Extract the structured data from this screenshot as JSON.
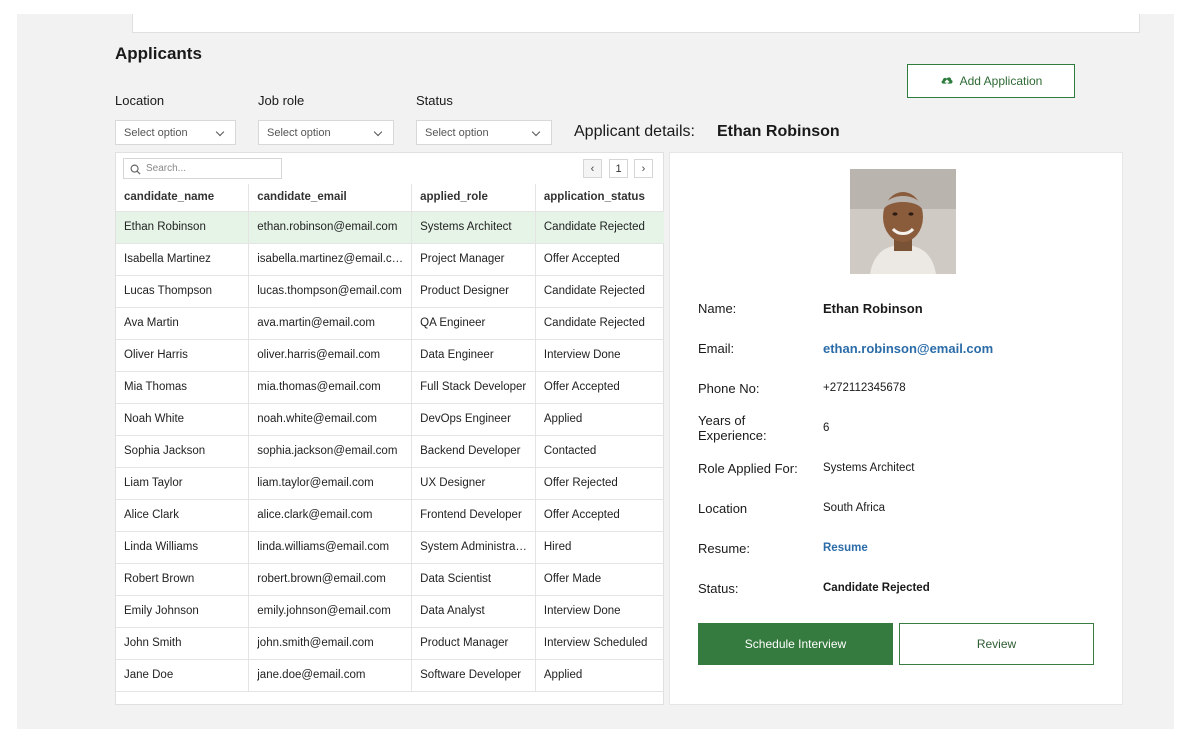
{
  "page": {
    "title": "Applicants",
    "add_button": "Add Application"
  },
  "filters": [
    {
      "label": "Location",
      "placeholder": "Select option"
    },
    {
      "label": "Job role",
      "placeholder": "Select option"
    },
    {
      "label": "Status",
      "placeholder": "Select option"
    }
  ],
  "table": {
    "search_placeholder": "Search...",
    "page": "1",
    "columns": [
      "candidate_name",
      "candidate_email",
      "applied_role",
      "application_status"
    ],
    "rows": [
      [
        "Ethan Robinson",
        "ethan.robinson@email.com",
        "Systems Architect",
        "Candidate Rejected"
      ],
      [
        "Isabella Martinez",
        "isabella.martinez@email.c…",
        "Project Manager",
        "Offer Accepted"
      ],
      [
        "Lucas Thompson",
        "lucas.thompson@email.com",
        "Product Designer",
        "Candidate Rejected"
      ],
      [
        "Ava Martin",
        "ava.martin@email.com",
        "QA Engineer",
        "Candidate Rejected"
      ],
      [
        "Oliver Harris",
        "oliver.harris@email.com",
        "Data Engineer",
        "Interview Done"
      ],
      [
        "Mia Thomas",
        "mia.thomas@email.com",
        "Full Stack Developer",
        "Offer Accepted"
      ],
      [
        "Noah White",
        "noah.white@email.com",
        "DevOps Engineer",
        "Applied"
      ],
      [
        "Sophia Jackson",
        "sophia.jackson@email.com",
        "Backend Developer",
        "Contacted"
      ],
      [
        "Liam Taylor",
        "liam.taylor@email.com",
        "UX Designer",
        "Offer Rejected"
      ],
      [
        "Alice Clark",
        "alice.clark@email.com",
        "Frontend Developer",
        "Offer Accepted"
      ],
      [
        "Linda Williams",
        "linda.williams@email.com",
        "System Administra…",
        "Hired"
      ],
      [
        "Robert Brown",
        "robert.brown@email.com",
        "Data Scientist",
        "Offer Made"
      ],
      [
        "Emily Johnson",
        "emily.johnson@email.com",
        "Data Analyst",
        "Interview Done"
      ],
      [
        "John Smith",
        "john.smith@email.com",
        "Product Manager",
        "Interview Scheduled"
      ],
      [
        "Jane Doe",
        "jane.doe@email.com",
        "Software Developer",
        "Applied"
      ]
    ],
    "selected_row": 0
  },
  "details": {
    "heading": "Applicant details:",
    "name_heading": "Ethan Robinson",
    "fields": {
      "name_label": "Name:",
      "name": "Ethan Robinson",
      "email_label": "Email:",
      "email": "ethan.robinson@email.com",
      "phone_label": "Phone No:",
      "phone": "+272112345678",
      "experience_label": "Years of Experience:",
      "experience": "6",
      "role_label": "Role Applied For:",
      "role": "Systems Architect",
      "location_label": "Location",
      "location": "South Africa",
      "resume_label": "Resume:",
      "resume": "Resume",
      "status_label": "Status:",
      "status": "Candidate Rejected"
    },
    "schedule_button": "Schedule Interview",
    "review_button": "Review"
  },
  "colors": {
    "accent": "#357a3e",
    "link": "#2b6ca8",
    "selected_row": "#e6f4e8"
  }
}
